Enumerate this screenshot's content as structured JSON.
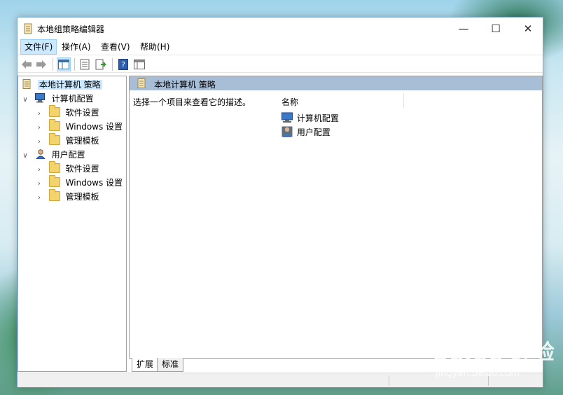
{
  "window": {
    "title": "本地组策略编辑器",
    "controls": {
      "minimize": "—",
      "maximize": "☐",
      "close": "✕"
    }
  },
  "menu": [
    {
      "label": "文件(F)",
      "active": true
    },
    {
      "label": "操作(A)"
    },
    {
      "label": "查看(V)"
    },
    {
      "label": "帮助(H)"
    }
  ],
  "toolbar": {
    "back": "←",
    "forward": "→"
  },
  "tree": {
    "root": "本地计算机 策略",
    "computer": {
      "label": "计算机配置",
      "children": [
        "软件设置",
        "Windows 设置",
        "管理模板"
      ]
    },
    "user": {
      "label": "用户配置",
      "children": [
        "软件设置",
        "Windows 设置",
        "管理模板"
      ]
    }
  },
  "details": {
    "header": "本地计算机 策略",
    "description": "选择一个项目来查看它的描述。",
    "column_name": "名称",
    "items": [
      "计算机配置",
      "用户配置"
    ]
  },
  "tabs": [
    "扩展",
    "标准"
  ],
  "watermark": {
    "main": "Baidu 经验",
    "sub": "jingyan.baidu.com"
  },
  "colors": {
    "accent": "#cce8ff",
    "header_bar": "#a8bdd6",
    "folder": "#f3d36b"
  }
}
